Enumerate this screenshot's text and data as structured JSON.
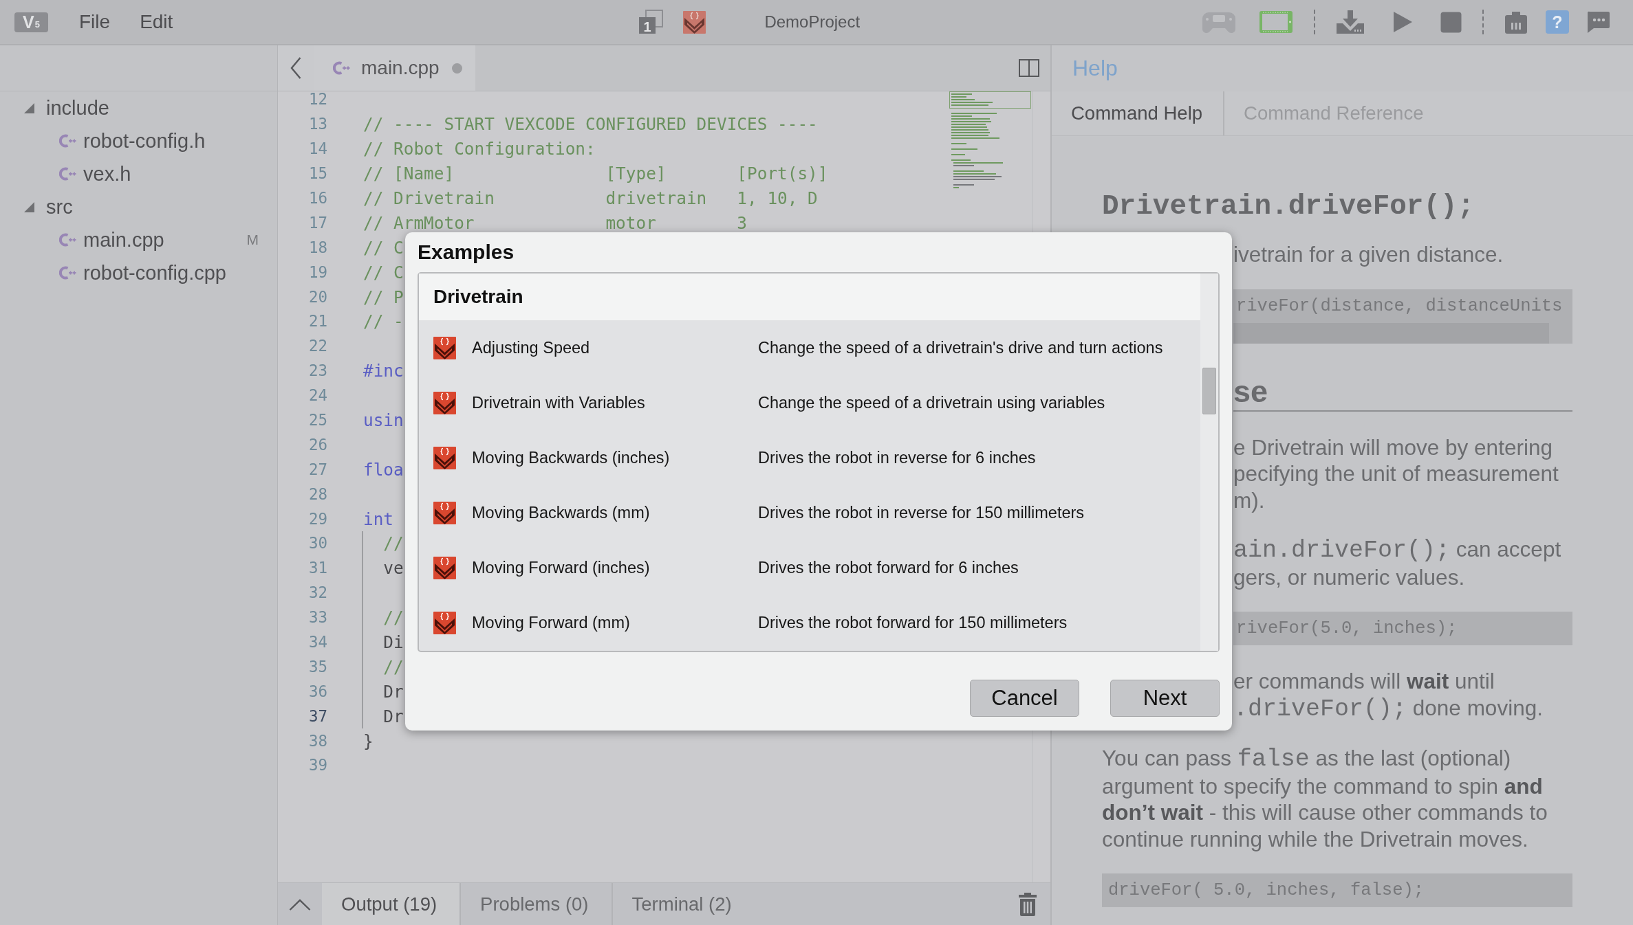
{
  "app_bar": {
    "logo": "V$_{5}$",
    "menus": [
      {
        "label": "File"
      },
      {
        "label": "Edit"
      }
    ],
    "slot": "1",
    "project_name": "DemoProject",
    "toolbar": [
      {
        "buttons": [
          {
            "kind": "controller",
            "disabled": true
          },
          {
            "kind": "brain",
            "disabled": false
          }
        ]
      },
      {
        "buttons": [
          {
            "kind": "download",
            "disabled": false
          },
          {
            "kind": "play",
            "disabled": false
          },
          {
            "kind": "stop",
            "disabled": false
          }
        ]
      },
      {
        "buttons": [
          {
            "kind": "device_info",
            "disabled": false
          },
          {
            "kind": "help",
            "label": "?",
            "disabled": false
          },
          {
            "kind": "feedback",
            "disabled": false
          }
        ]
      }
    ]
  },
  "sidebar": {
    "tree": [
      {
        "kind": "folder",
        "label": "include",
        "expanded": true,
        "children": [
          {
            "kind": "file",
            "label": "robot-config.h"
          },
          {
            "kind": "file",
            "label": "vex.h"
          }
        ]
      },
      {
        "kind": "folder",
        "label": "src",
        "expanded": true,
        "children": [
          {
            "kind": "file",
            "label": "main.cpp",
            "status": "M"
          },
          {
            "kind": "file",
            "label": "robot-config.cpp"
          }
        ]
      }
    ]
  },
  "editor": {
    "tabs": [
      {
        "label": "main.cpp",
        "selected": true,
        "unsaved": true
      }
    ],
    "lines": [
      {
        "number": "12",
        "current": false
      },
      {
        "number": "13",
        "kind": "comment",
        "text": "// ---- START VEXCODE CONFIGURED DEVICES ----",
        "current": false
      },
      {
        "number": "14",
        "kind": "comment",
        "text": "// Robot Configuration:",
        "current": false
      },
      {
        "number": "15",
        "kind": "comment",
        "text": "// [Name]               [Type]       [Port(s)]",
        "current": false
      },
      {
        "number": "16",
        "kind": "comment",
        "text": "// Drivetrain           drivetrain   1, 10, D",
        "current": false
      },
      {
        "number": "17",
        "kind": "comment",
        "text": "// ArmMotor             motor        3",
        "current": false
      },
      {
        "number": "18",
        "kind": "comment",
        "text": "// C",
        "current": false
      },
      {
        "number": "19",
        "kind": "comment",
        "text": "// C",
        "current": false
      },
      {
        "number": "20",
        "kind": "comment",
        "text": "// P",
        "current": false
      },
      {
        "number": "21",
        "kind": "comment",
        "text": "// -",
        "current": false
      },
      {
        "number": "22",
        "current": false
      },
      {
        "number": "23",
        "kind": "keyword",
        "text": "#inc",
        "current": false
      },
      {
        "number": "24",
        "current": false
      },
      {
        "number": "25",
        "kind": "keyword",
        "text": "usin",
        "current": false
      },
      {
        "number": "26",
        "current": false
      },
      {
        "number": "27",
        "kind": "keyword",
        "text": "floa",
        "current": false
      },
      {
        "number": "28",
        "current": false
      },
      {
        "number": "29",
        "kind": "keyword",
        "text": "int",
        "current": false
      },
      {
        "number": "30",
        "kind": "comment",
        "text": "  //",
        "current": false
      },
      {
        "number": "31",
        "kind": "plain",
        "text": "  ve",
        "current": false
      },
      {
        "number": "32",
        "current": false
      },
      {
        "number": "33",
        "kind": "comment",
        "text": "  //",
        "current": false
      },
      {
        "number": "34",
        "kind": "plain",
        "text": "  Di",
        "current": false
      },
      {
        "number": "35",
        "kind": "comment",
        "text": "  //",
        "current": false
      },
      {
        "number": "36",
        "kind": "plain",
        "text": "  Dr",
        "current": false
      },
      {
        "number": "37",
        "kind": "plain",
        "text": "  Dr",
        "current": true
      },
      {
        "number": "38",
        "kind": "plain",
        "text": "}",
        "current": false
      },
      {
        "number": "39",
        "current": false
      }
    ]
  },
  "bottom_panel": {
    "tabs": [
      {
        "label": "Output (19)",
        "selected": true
      },
      {
        "label": "Problems (0)",
        "selected": false
      },
      {
        "label": "Terminal (2)",
        "selected": false
      }
    ]
  },
  "help": {
    "title": "Help",
    "tabs": [
      {
        "label": "Command Help",
        "selected": true
      },
      {
        "label": "Command Reference",
        "selected": false
      }
    ],
    "content": [
      {
        "kind": "signature",
        "text": "Drivetrain.driveFor();"
      },
      {
        "kind": "paragraph",
        "covered": true,
        "lines": [
          [
            {
              "kind": "text",
              "text": "ivetrain for a given distance."
            }
          ]
        ]
      },
      {
        "kind": "code",
        "covered": true,
        "scrollable": true,
        "text": "riveFor(distance, distanceUnits"
      },
      {
        "kind": "heading",
        "covered": true,
        "text": "se"
      },
      {
        "kind": "paragraph",
        "covered": true,
        "lines": [
          [
            {
              "kind": "text",
              "text": "e Drivetrain will move by entering"
            }
          ],
          [
            {
              "kind": "text",
              "text": "pecifying the unit of measurement"
            }
          ],
          [
            {
              "kind": "text",
              "text": "m)."
            }
          ]
        ]
      },
      {
        "kind": "paragraph",
        "covered": true,
        "lines": [
          [
            {
              "kind": "code",
              "text": "ain.driveFor();"
            },
            {
              "kind": "text",
              "text": " can accept"
            }
          ],
          [
            {
              "kind": "text",
              "text": "gers, or numeric values."
            }
          ]
        ]
      },
      {
        "kind": "code",
        "covered": true,
        "scrollable": false,
        "text": "riveFor(5.0, inches);"
      },
      {
        "kind": "paragraph",
        "covered": true,
        "lines": [
          [
            {
              "kind": "text",
              "text": "er commands will "
            },
            {
              "kind": "bold",
              "text": "wait"
            },
            {
              "kind": "text",
              "text": " until"
            }
          ],
          [
            {
              "kind": "code",
              "text": ".driveFor();"
            },
            {
              "kind": "text",
              "text": " done moving."
            }
          ]
        ]
      },
      {
        "kind": "paragraph",
        "covered": false,
        "lines": [
          [
            {
              "kind": "text",
              "text": "You can pass "
            },
            {
              "kind": "code",
              "text": "false"
            },
            {
              "kind": "text",
              "text": " as the last (optional)"
            }
          ],
          [
            {
              "kind": "text",
              "text": "argument to specify the command to spin "
            },
            {
              "kind": "bold",
              "text": "and"
            }
          ],
          [
            {
              "kind": "bold",
              "text": "don’t wait"
            },
            {
              "kind": "text",
              "text": " - this will cause other commands to"
            }
          ],
          [
            {
              "kind": "text",
              "text": "continue running while the Drivetrain moves."
            }
          ]
        ]
      },
      {
        "kind": "code",
        "covered": false,
        "scrollable": false,
        "text": "driveFor( 5.0, inches, false);"
      }
    ]
  },
  "dialog": {
    "title": "Examples",
    "section": "Drivetrain",
    "examples": [
      {
        "name": "Adjusting Speed",
        "description": "Change the speed of a drivetrain's drive and turn actions",
        "selected": false
      },
      {
        "name": "Drivetrain with Variables",
        "description": "Change the speed of a drivetrain using variables",
        "selected": false
      },
      {
        "name": "Moving Backwards (inches)",
        "description": "Drives the robot in reverse for 6 inches",
        "selected": false
      },
      {
        "name": "Moving Backwards (mm)",
        "description": "Drives the robot in reverse for 150 millimeters",
        "selected": false
      },
      {
        "name": "Moving Forward (inches)",
        "description": "Drives the robot forward for 6 inches",
        "selected": false
      },
      {
        "name": "Moving Forward (mm)",
        "description": "Drives the robot forward for 150 millimeters",
        "selected": false
      }
    ],
    "buttons": [
      {
        "label": "Cancel"
      },
      {
        "label": "Next"
      }
    ]
  }
}
